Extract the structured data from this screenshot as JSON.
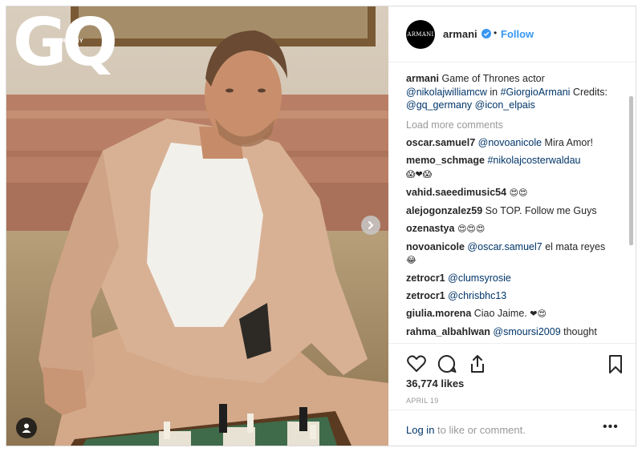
{
  "photo": {
    "logo": "GQ",
    "logo_sub": "GERMANY",
    "next_icon": "chevron-right-icon",
    "tag_icon": "user-tag-icon"
  },
  "header": {
    "avatar_text": "ARMANI",
    "username": "armani",
    "dot": "•",
    "follow": "Follow"
  },
  "caption": {
    "user": "armani",
    "text_1": " Game of Thrones actor ",
    "mention_1": "@nikolajwilliamcw",
    "text_2": " in ",
    "hashtag": "#GiorgioArmani",
    "text_3": " Credits: ",
    "mention_2": "@gq_germany",
    "mention_3": "@icon_elpais"
  },
  "load_more": "Load more comments",
  "comments": [
    {
      "user": "oscar.samuel7",
      "mention": "@novoanicole",
      "text": " Mira Amor!"
    },
    {
      "user": "memo_schmage",
      "mention": "#nikolajcosterwaldau",
      "text": "",
      "emoji": "😱❤😱"
    },
    {
      "user": "vahid.saeedimusic54",
      "mention": "",
      "text": " ",
      "emoji": "😍😍"
    },
    {
      "user": "alejogonzalez59",
      "mention": "",
      "text": " So TOP. Follow me Guys"
    },
    {
      "user": "ozenastya",
      "mention": "",
      "text": " ",
      "emoji": "😍😍😍"
    },
    {
      "user": "novoanicole",
      "mention": "@oscar.samuel7",
      "text": " el mata reyes",
      "emoji": "😂"
    },
    {
      "user": "zetrocr1",
      "mention": "@clumsyrosie",
      "text": ""
    },
    {
      "user": "zetrocr1",
      "mention": "@chrisbhc13",
      "text": ""
    },
    {
      "user": "giulia.morena",
      "mention": "",
      "text": " Ciao Jaime. ",
      "emoji": "❤😍"
    },
    {
      "user": "rahma_albahlwan",
      "mention": "@smoursi2009",
      "text": " thought"
    }
  ],
  "likes": "36,774 likes",
  "date": "APRIL 19",
  "login": {
    "link": "Log in",
    "text": " to like or comment.",
    "more": "•••"
  },
  "colors": {
    "link": "#003569",
    "follow": "#3897f0",
    "muted": "#999999"
  }
}
